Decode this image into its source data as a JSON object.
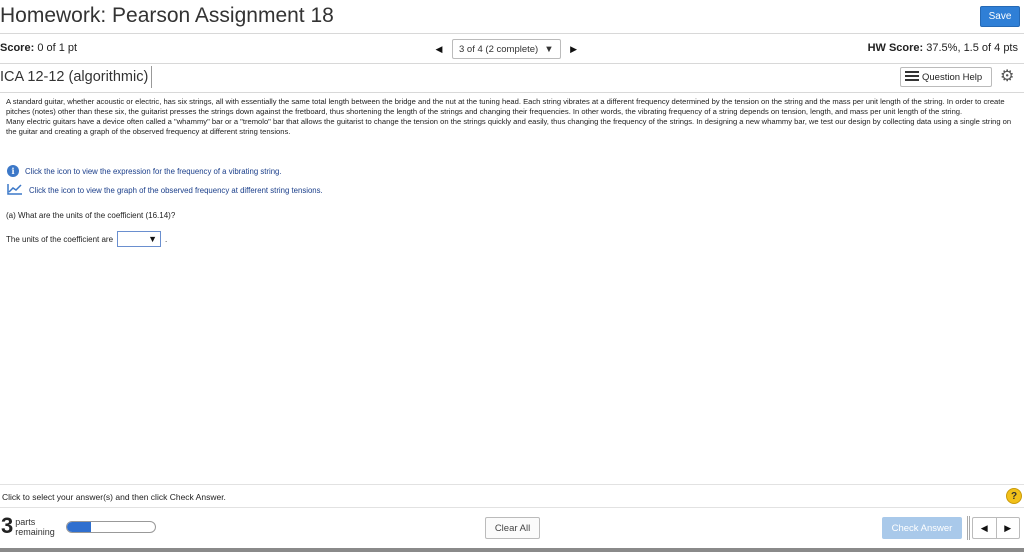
{
  "header": {
    "title": "Homework: Pearson Assignment 18",
    "save_label": "Save"
  },
  "score_bar": {
    "score_label": "Score:",
    "score_value": "0 of 1 pt",
    "nav_select": "3 of 4 (2 complete)",
    "hw_score_label": "HW Score:",
    "hw_score_value": "37.5%, 1.5 of 4 pts"
  },
  "question": {
    "title": "ICA 12-12 (algorithmic)",
    "help_label": "Question Help",
    "paragraph1": "A standard guitar, whether acoustic or electric, has six strings, all with essentially the same total length between the bridge and the nut at the tuning head. Each string vibrates at a different frequency determined by the tension on the string and the mass per unit length of the string. In order to create pitches (notes) other than these six, the guitarist presses the strings down against the fretboard, thus shortening the length of the strings and changing their frequencies. In other words, the vibrating frequency of a string depends on tension, length, and mass per unit length of the string.",
    "paragraph2": "Many electric guitars have a device often called a \"whammy\" bar or a \"tremolo\" bar that allows the guitarist to change the tension on the strings quickly and easily, thus changing the frequency of the strings. In designing a new whammy bar, we test our design by collecting data using a single string on the guitar and creating a graph of the observed frequency at different string tensions.",
    "link1": "Click the icon to view the expression for the frequency of a vibrating string.",
    "link2": "Click the icon to view the graph of the observed frequency at different string tensions.",
    "part_a": "(a) What are the units of the coefficient (16.14)?",
    "answer_prefix": "The units of the coefficient are",
    "answer_suffix": "."
  },
  "footer": {
    "instruction": "Click to select your answer(s) and then click Check Answer.",
    "parts_count": "3",
    "parts_label_1": "parts",
    "parts_label_2": "remaining",
    "progress_fraction": 0.27,
    "clear_label": "Clear All",
    "check_label": "Check Answer"
  },
  "icons": {
    "info": "info-icon",
    "graph": "line-chart-icon",
    "gear": "gear-icon",
    "help": "question-mark-icon",
    "list": "list-icon"
  },
  "colors": {
    "accent": "#2f7fd6",
    "check_disabled": "#a9c9ea",
    "help_yellow": "#f2c019",
    "link": "#1a3e8a"
  }
}
